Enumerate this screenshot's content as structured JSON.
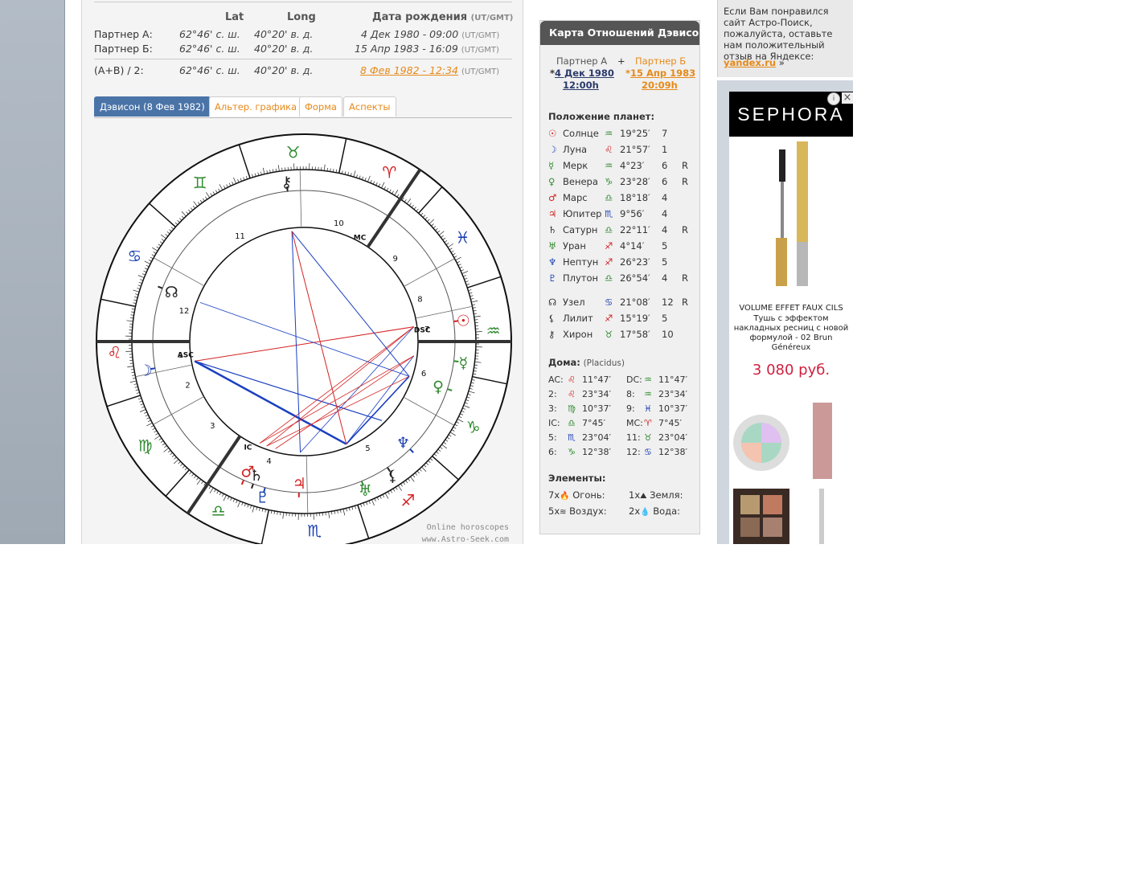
{
  "header": {
    "col_lat": "Lat",
    "col_long": "Long",
    "col_birth": "Дата рождения",
    "col_birth_tz": "(UT/GMT)"
  },
  "rows": [
    {
      "label": "Партнер А:",
      "lat": "62°46' с. ш.",
      "long": "40°20' в. д.",
      "date": "4 Дек 1980 - 09:00",
      "tz": "(UT/GMT)"
    },
    {
      "label": "Партнер Б:",
      "lat": "62°46' с. ш.",
      "long": "40°20' в. д.",
      "date": "15 Апр 1983 - 16:09",
      "tz": "(UT/GMT)"
    },
    {
      "label": "(A+B) / 2:",
      "lat": "62°46' с. ш.",
      "long": "40°20' в. д.",
      "date": "8 Фев 1982 - 12:34",
      "tz": "(UT/GMT)"
    }
  ],
  "tabs": [
    "Дэвисон (8 Фев 1982)",
    "Альтер. графика",
    "Форма",
    "Аспекты"
  ],
  "watermark": [
    "Online horoscopes",
    "www.Astro-Seek.com"
  ],
  "chart": {
    "house_numbers": [
      "1",
      "2",
      "3",
      "4",
      "5",
      "6",
      "7",
      "8",
      "9",
      "10",
      "11",
      "12"
    ],
    "angles": [
      "ASC",
      "IC",
      "DSC",
      "MC"
    ],
    "colors": {
      "fire": "#d42020",
      "earth": "#2f8a2f",
      "air": "#2f8a2f",
      "water": "#1a3fb0",
      "aspect_red": "#d42020",
      "aspect_blue": "#1a3fc0"
    }
  },
  "panel": {
    "title": "Карта Отношений Дэвисона",
    "partner_a": "Партнер А",
    "plus": "+",
    "partner_b": "Партнер Б",
    "star": "*",
    "a_date": "4 Дек 1980",
    "a_time": "12:00h",
    "b_date": "15 Апр 1983",
    "b_time": "20:09h",
    "planets_title": "Положение планет:",
    "planets": [
      {
        "glyph": "☉",
        "name": "Солнце",
        "sign": "♒",
        "deg": "19°25′",
        "house": "7",
        "r": ""
      },
      {
        "glyph": "☽",
        "name": "Луна",
        "sign": "♌",
        "deg": "21°57′",
        "house": "1",
        "r": ""
      },
      {
        "glyph": "☿",
        "name": "Мерк",
        "sign": "♒",
        "deg": "4°23′",
        "house": "6",
        "r": "R"
      },
      {
        "glyph": "♀",
        "name": "Венера",
        "sign": "♑",
        "deg": "23°28′",
        "house": "6",
        "r": "R"
      },
      {
        "glyph": "♂",
        "name": "Марс",
        "sign": "♎",
        "deg": "18°18′",
        "house": "4",
        "r": ""
      },
      {
        "glyph": "♃",
        "name": "Юпитер",
        "sign": "♏",
        "deg": "9°56′",
        "house": "4",
        "r": ""
      },
      {
        "glyph": "♄",
        "name": "Сатурн",
        "sign": "♎",
        "deg": "22°11′",
        "house": "4",
        "r": "R"
      },
      {
        "glyph": "♅",
        "name": "Уран",
        "sign": "♐",
        "deg": "4°14′",
        "house": "5",
        "r": ""
      },
      {
        "glyph": "♆",
        "name": "Нептун",
        "sign": "♐",
        "deg": "26°23′",
        "house": "5",
        "r": ""
      },
      {
        "glyph": "♇",
        "name": "Плутон",
        "sign": "♎",
        "deg": "26°54′",
        "house": "4",
        "r": "R"
      },
      {
        "glyph": "☊",
        "name": "Узел",
        "sign": "♋",
        "deg": "21°08′",
        "house": "12",
        "r": "R"
      },
      {
        "glyph": "⚸",
        "name": "Лилит",
        "sign": "♐",
        "deg": "15°19′",
        "house": "5",
        "r": ""
      },
      {
        "glyph": "⚷",
        "name": "Хирон",
        "sign": "♉",
        "deg": "17°58′",
        "house": "10",
        "r": ""
      }
    ],
    "houses_title": "Дома:",
    "houses_system": "(Placidus)",
    "houses": [
      {
        "l": "AC:",
        "ls": "♌",
        "lv": "11°47′",
        "r": "DC:",
        "rs": "♒",
        "rv": "11°47′"
      },
      {
        "l": "2:",
        "ls": "♌",
        "lv": "23°34′",
        "r": "8:",
        "rs": "♒",
        "rv": "23°34′"
      },
      {
        "l": "3:",
        "ls": "♍",
        "lv": "10°37′",
        "r": "9:",
        "rs": "♓",
        "rv": "10°37′"
      },
      {
        "l": "IC:",
        "ls": "♎",
        "lv": "7°45′",
        "r": "MC:",
        "rs": "♈",
        "rv": "7°45′"
      },
      {
        "l": "5:",
        "ls": "♏",
        "lv": "23°04′",
        "r": "11:",
        "rs": "♉",
        "rv": "23°04′"
      },
      {
        "l": "6:",
        "ls": "♑",
        "lv": "12°38′",
        "r": "12:",
        "rs": "♋",
        "rv": "12°38′"
      }
    ],
    "elements_title": "Элементы:",
    "elements": [
      {
        "count": "7x",
        "icon": "🔥",
        "name": "Огонь:"
      },
      {
        "count": "1x",
        "icon": "⛰",
        "name": "Земля:"
      },
      {
        "count": "5x",
        "icon": "≋",
        "name": "Воздух:"
      },
      {
        "count": "2x",
        "icon": "💧",
        "name": "Вода:"
      }
    ]
  },
  "sidebar": {
    "text": "Если Вам понравился сайт Астро-Поиск, пожалуйста, оставьте нам положительный отзыв на Яндексе:",
    "link": "yandex.ru",
    "link_suffix": "»"
  },
  "ad": {
    "brand": "SEPHORA",
    "product_title": "VOLUME EFFET FAUX CILS",
    "product_desc": "Тушь с эффектом накладных ресниц с новой формулой - 02 Brun Généreux",
    "price": "3 080 руб.",
    "info_icon": "i",
    "close_icon": "×"
  }
}
